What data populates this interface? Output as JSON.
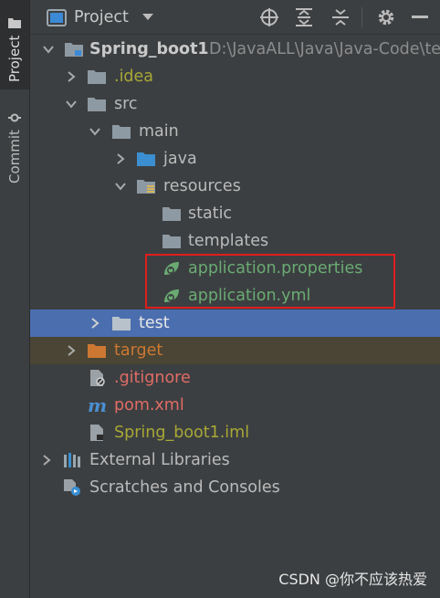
{
  "sidebar": {
    "tab_project": "Project",
    "tab_commit": "Commit"
  },
  "toolbar": {
    "view_label": "Project"
  },
  "tree": {
    "root": {
      "name": "Spring_boot1",
      "path": "D:\\JavaALL\\Java\\Java-Code\\te"
    },
    "idea": ".idea",
    "src": "src",
    "main": "main",
    "java": "java",
    "resources": "resources",
    "static": "static",
    "templates": "templates",
    "app_properties": "application.properties",
    "app_yml": "application.yml",
    "test": "test",
    "target": "target",
    "gitignore": ".gitignore",
    "pom": "pom.xml",
    "iml": "Spring_boot1.iml",
    "external_libraries": "External Libraries",
    "scratches": "Scratches and Consoles"
  },
  "colors": {
    "spring_green": "#6aab73",
    "excluded_orange": "#cc7832",
    "ignored_red": "#e06c66",
    "iml_olive": "#a8a836",
    "selection_blue": "#4b6eaf"
  },
  "watermark": "CSDN @你不应该热爱"
}
